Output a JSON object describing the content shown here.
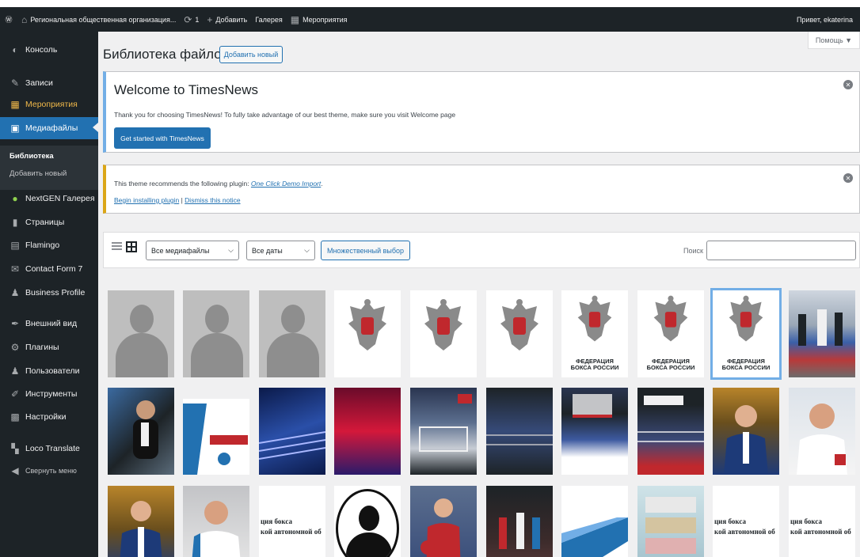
{
  "adminbar": {
    "site_name": "Региональная общественная организация...",
    "updates_count": "1",
    "add_label": "Добавить",
    "gallery_label": "Галерея",
    "events_label": "Мероприятия",
    "greeting": "Привет, ekaterina"
  },
  "sidebar": {
    "items": [
      {
        "label": "Консоль",
        "icon": "dashboard-icon"
      },
      {
        "label": "Записи",
        "icon": "pin-icon"
      },
      {
        "label": "Мероприятия",
        "icon": "calendar-icon"
      },
      {
        "label": "Медиафайлы",
        "icon": "media-icon"
      },
      {
        "label": "NextGEN Галерея",
        "icon": "nextgen-icon"
      },
      {
        "label": "Страницы",
        "icon": "page-icon"
      },
      {
        "label": "Flamingo",
        "icon": "flamingo-icon"
      },
      {
        "label": "Contact Form 7",
        "icon": "mail-icon"
      },
      {
        "label": "Business Profile",
        "icon": "user-icon"
      },
      {
        "label": "Внешний вид",
        "icon": "brush-icon"
      },
      {
        "label": "Плагины",
        "icon": "plugin-icon"
      },
      {
        "label": "Пользователи",
        "icon": "users-icon"
      },
      {
        "label": "Инструменты",
        "icon": "wrench-icon"
      },
      {
        "label": "Настройки",
        "icon": "settings-icon"
      },
      {
        "label": "Loco Translate",
        "icon": "translate-icon"
      },
      {
        "label": "Свернуть меню",
        "icon": "collapse-icon"
      }
    ],
    "submenu": {
      "library": "Библиотека",
      "add_new": "Добавить новый"
    }
  },
  "header": {
    "help_label": "Помощь ▼",
    "title": "Библиотека файлов",
    "add_new_label": "Добавить новый"
  },
  "welcome_notice": {
    "title": "Welcome to TimesNews",
    "text": "Thank you for choosing TimesNews! To fully take advantage of our best theme, make sure you visit Welcome page",
    "button": "Get started with TimesNews"
  },
  "plugin_notice": {
    "text_prefix": "This theme recommends the following plugin: ",
    "plugin_link": "One Click Demo Import",
    "text_suffix": ".",
    "install_link": "Begin installing plugin",
    "separator": " | ",
    "dismiss_link": "Dismiss this notice"
  },
  "toolbar": {
    "filter_media": "Все медиафайлы",
    "filter_dates": "Все даты",
    "bulk_select": "Множественный выбор",
    "search_label": "Поиск",
    "search_value": ""
  },
  "media": {
    "emblem_caption_line1": "ФЕДЕРАЦИЯ",
    "emblem_caption_line2": "БОКСА РОССИИ",
    "text_thumb_line1": "ция бокса",
    "text_thumb_line2": "кой автономной об"
  },
  "colors": {
    "admin_dark": "#1d2327",
    "accent": "#2271b1",
    "notice_info": "#72aee6",
    "notice_warning": "#dba617"
  }
}
